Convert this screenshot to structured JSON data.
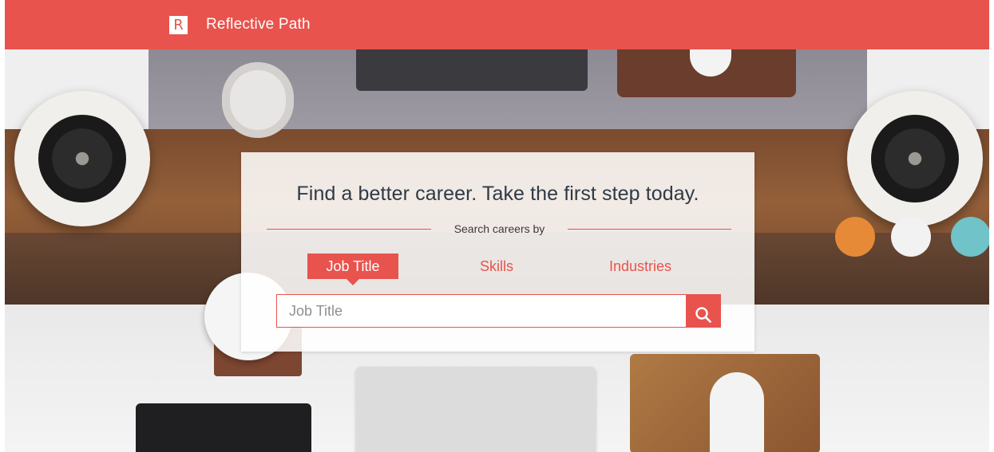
{
  "header": {
    "logo_letter": "R",
    "brand_name": "Reflective Path"
  },
  "hero": {
    "headline": "Find a better career. Take the first step today.",
    "search_by_label": "Search careers by",
    "tabs": [
      {
        "label": "Job Title",
        "active": true
      },
      {
        "label": "Skills",
        "active": false
      },
      {
        "label": "Industries",
        "active": false
      }
    ],
    "search": {
      "placeholder": "Job Title",
      "value": ""
    }
  },
  "colors": {
    "accent": "#e8534d",
    "text_dark": "#2f3a45"
  },
  "icons": {
    "search": "search-icon",
    "logo": "logo-icon"
  }
}
